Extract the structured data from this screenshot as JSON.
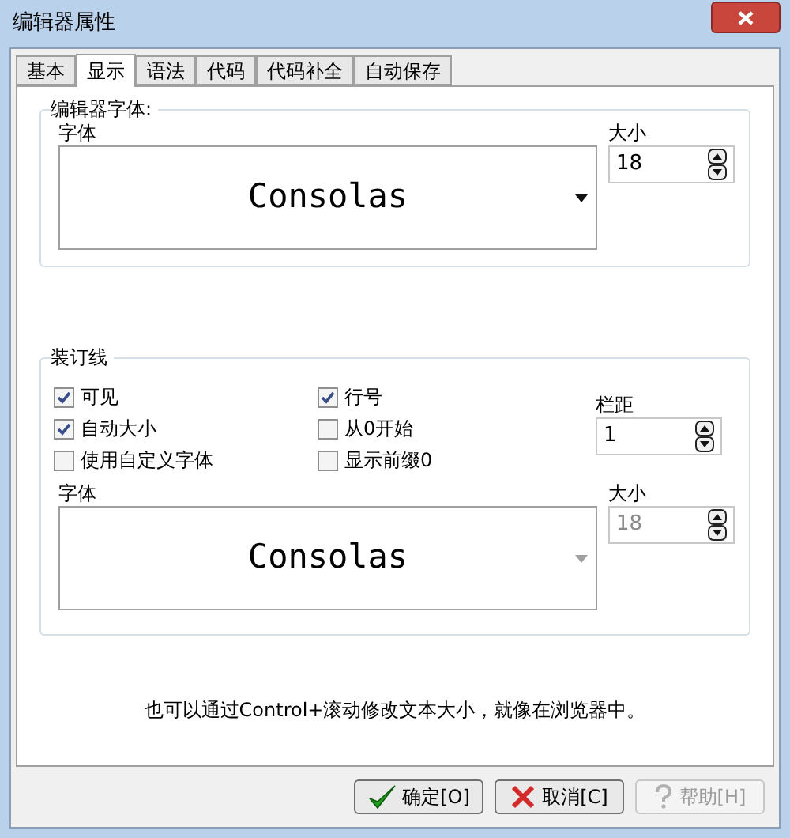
{
  "window": {
    "title": "编辑器属性"
  },
  "tabs": [
    {
      "label": "基本",
      "selected": false
    },
    {
      "label": "显示",
      "selected": true
    },
    {
      "label": "语法",
      "selected": false
    },
    {
      "label": "代码",
      "selected": false
    },
    {
      "label": "代码补全",
      "selected": false
    },
    {
      "label": "自动保存",
      "selected": false
    }
  ],
  "editor_font": {
    "title": "编辑器字体:",
    "font_label": "字体",
    "font": {
      "value": "Consolas",
      "disabled": false
    },
    "size_label": "大小",
    "size": {
      "value": "18",
      "disabled": false
    }
  },
  "gutter": {
    "title": "装订线",
    "checkboxes": [
      {
        "label": "可见",
        "checked": true
      },
      {
        "label": "自动大小",
        "checked": true
      },
      {
        "label": "使用自定义字体",
        "checked": false
      },
      {
        "label": "行号",
        "checked": true
      },
      {
        "label": "从0开始",
        "checked": false
      },
      {
        "label": "显示前缀0",
        "checked": false
      }
    ],
    "spacing_label": "栏距",
    "spacing": {
      "value": "1",
      "disabled": false
    },
    "font_label": "字体",
    "font": {
      "value": "Consolas",
      "disabled": true
    },
    "size_label": "大小",
    "size": {
      "value": "18",
      "disabled": true
    }
  },
  "note": "也可以通过Control+滚动修改文本大小，就像在浏览器中。",
  "buttons": [
    {
      "kind": "ok",
      "label": "确定[O]",
      "disabled": false
    },
    {
      "kind": "cancel",
      "label": "取消[C]",
      "disabled": false
    },
    {
      "kind": "help",
      "label": "帮助[H]",
      "disabled": true
    }
  ]
}
